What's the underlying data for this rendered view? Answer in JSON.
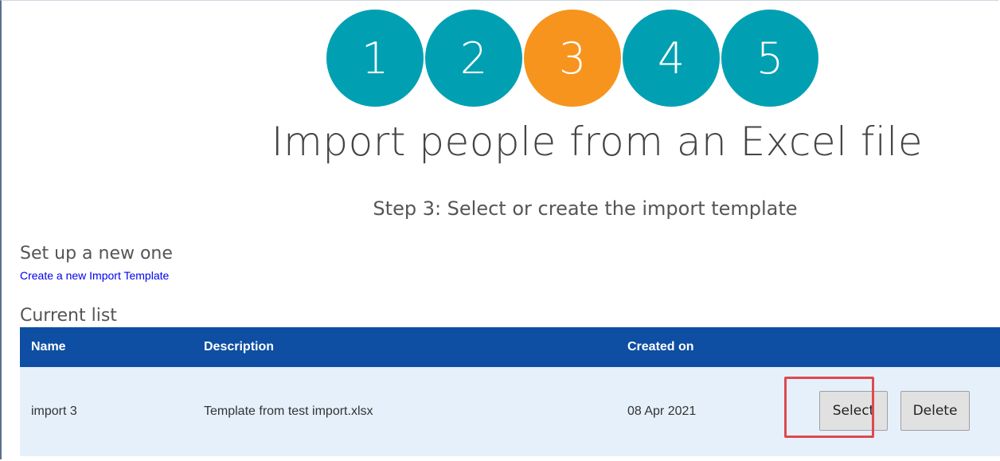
{
  "wizard": {
    "steps": [
      "1",
      "2",
      "3",
      "4",
      "5"
    ],
    "active_step": 3
  },
  "header": {
    "title": "Import people from an Excel file",
    "subtitle": "Step 3: Select or create the import template"
  },
  "new_section": {
    "heading": "Set up a new one",
    "link_label": "Create a new Import Template"
  },
  "list_section": {
    "heading": "Current list",
    "columns": [
      "Name",
      "Description",
      "Created on"
    ],
    "rows": [
      {
        "name": "import 3",
        "description": "Template from test import.xlsx",
        "created_on": "08 Apr 2021",
        "select_label": "Select",
        "delete_label": "Delete"
      }
    ]
  },
  "colors": {
    "step_default": "#00a0b2",
    "step_active": "#f7941d",
    "table_header": "#0e4ea3",
    "row_background": "#e6f0fb",
    "highlight": "#e0484e"
  }
}
